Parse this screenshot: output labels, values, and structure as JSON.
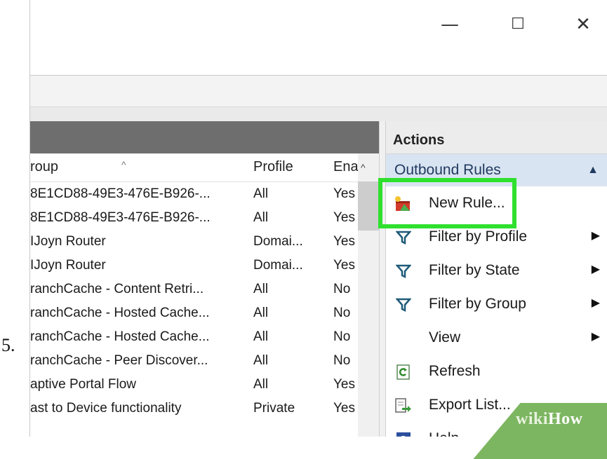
{
  "step_number": "5.",
  "window_controls": {
    "minimize": "—",
    "maximize": "☐",
    "close": "✕"
  },
  "list": {
    "sort_indicator": "^",
    "columns": [
      "roup",
      "Profile",
      "Ena"
    ],
    "scroll_up": "^",
    "rows": [
      [
        "8E1CD88-49E3-476E-B926-...",
        "All",
        "Yes"
      ],
      [
        "8E1CD88-49E3-476E-B926-...",
        "All",
        "Yes"
      ],
      [
        "IJoyn Router",
        "Domai...",
        "Yes"
      ],
      [
        "IJoyn Router",
        "Domai...",
        "Yes"
      ],
      [
        "ranchCache - Content Retri...",
        "All",
        "No"
      ],
      [
        "ranchCache - Hosted Cache...",
        "All",
        "No"
      ],
      [
        "ranchCache - Hosted Cache...",
        "All",
        "No"
      ],
      [
        "ranchCache - Peer Discover...",
        "All",
        "No"
      ],
      [
        "aptive Portal Flow",
        "All",
        "Yes"
      ],
      [
        "ast to Device functionality",
        "Private",
        "Yes"
      ]
    ]
  },
  "actions": {
    "title": "Actions",
    "section": "Outbound Rules",
    "section_toggle": "▲",
    "items": [
      {
        "label": "New Rule...",
        "icon": "new-rule-icon",
        "submenu": ""
      },
      {
        "label": "Filter by Profile",
        "icon": "filter-icon",
        "submenu": "▶"
      },
      {
        "label": "Filter by State",
        "icon": "filter-icon",
        "submenu": "▶"
      },
      {
        "label": "Filter by Group",
        "icon": "filter-icon",
        "submenu": "▶"
      },
      {
        "label": "View",
        "icon": "",
        "submenu": "▶"
      },
      {
        "label": "Refresh",
        "icon": "refresh-icon",
        "submenu": ""
      },
      {
        "label": "Export List...",
        "icon": "export-icon",
        "submenu": ""
      },
      {
        "label": "Help",
        "icon": "help-icon",
        "submenu": ""
      }
    ]
  },
  "highlight_color": "#2fe02f",
  "watermark": {
    "part1": "wiki",
    "part2": "How"
  }
}
